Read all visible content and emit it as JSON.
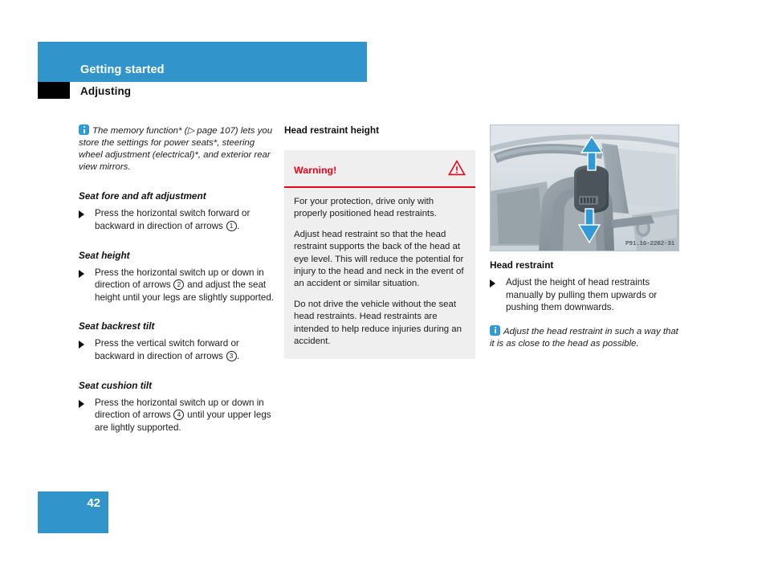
{
  "header": {
    "band_title": "Getting started",
    "section_title": "Adjusting"
  },
  "footer": {
    "page_number": "42"
  },
  "column_left": {
    "intro_note": "The memory function* (▷ page 107) lets you store the settings for power seats*, steering wheel adjustment (electrical)*, and exterior rear view mirrors.",
    "sections": [
      {
        "heading": "Seat fore and aft adjustment",
        "bullet_pre": "Press the horizontal switch forward or backward in direction of arrows ",
        "bullet_num": "1",
        "bullet_post": "."
      },
      {
        "heading": "Seat height",
        "bullet_pre": "Press the horizontal switch up or down in direction of arrows ",
        "bullet_num": "2",
        "bullet_post": " and adjust the seat height until your legs are slightly supported."
      },
      {
        "heading": "Seat backrest tilt",
        "bullet_pre": "Press the vertical switch forward or backward in direction of arrows ",
        "bullet_num": "3",
        "bullet_post": "."
      },
      {
        "heading": "Seat cushion tilt",
        "bullet_pre": "Press the horizontal switch up or down in direction of arrows ",
        "bullet_num": "4",
        "bullet_post": " until your upper legs are lightly supported."
      }
    ]
  },
  "column_middle": {
    "heading": "Head restraint height",
    "warning": {
      "title": "Warning!",
      "paragraphs": [
        "For your protection, drive only with properly positioned head restraints.",
        "Adjust head restraint so that the head restraint supports the back of the head at eye level. This will reduce the potential for injury to the head and neck in the event of an accident or similar situation.",
        "Do not drive the vehicle without the seat head restraints. Head restraints are intended to help reduce injuries during an accident."
      ]
    }
  },
  "column_right": {
    "illustration_code": "P91.16-2262-31",
    "caption": "Head restraint",
    "bullet": "Adjust the height of head restraints manually by pulling them upwards or pushing them downwards.",
    "note": "Adjust the head restraint in such a way that it is as close to the head as possible."
  },
  "colors": {
    "brand_blue": "#3195cc",
    "warning_red": "#e8051b",
    "info_blue": "#2e9ad6",
    "warning_bg": "#efefef"
  }
}
